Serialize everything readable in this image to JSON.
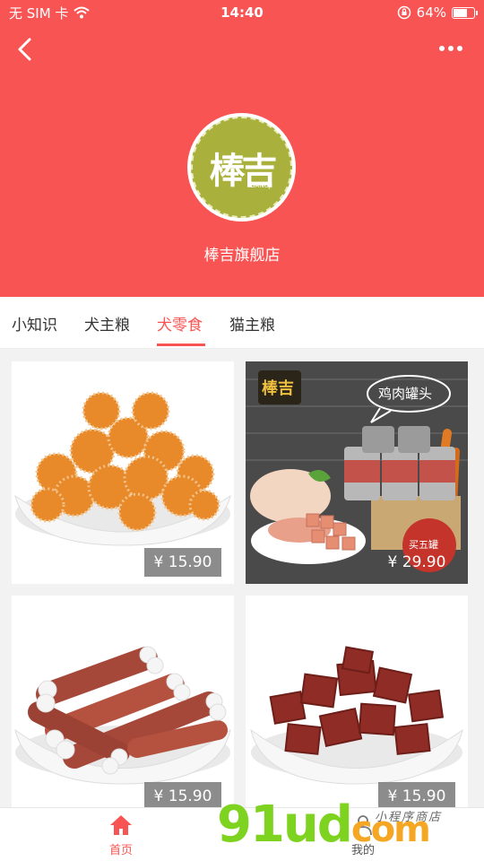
{
  "status_bar": {
    "carrier": "无 SIM 卡",
    "time": "14:40",
    "battery": "64%",
    "battery_level": 0.64
  },
  "header": {
    "logo_text": "棒吉",
    "logo_sub": "BANGJI",
    "store_name": "棒吉旗舰店"
  },
  "tabs": [
    {
      "label": "小知识",
      "active": false
    },
    {
      "label": "犬主粮",
      "active": false
    },
    {
      "label": "犬零食",
      "active": true
    },
    {
      "label": "猫主粮",
      "active": false
    }
  ],
  "products": [
    {
      "price": "¥ 15.90"
    },
    {
      "price": "¥ 29.90",
      "image_logo": "棒吉",
      "image_bubble": "鸡肉罐头",
      "image_badge": "买五罐"
    },
    {
      "price": "¥ 15.90"
    },
    {
      "price": "¥ 15.90"
    }
  ],
  "bottom_nav": {
    "home_label": "首页",
    "me_label": "我的"
  },
  "watermark": {
    "main": "91ud",
    "suffix": "com",
    "tagline": "小程序商店"
  },
  "colors": {
    "brand_red": "#f95454",
    "logo_green": "#a9b03b"
  }
}
